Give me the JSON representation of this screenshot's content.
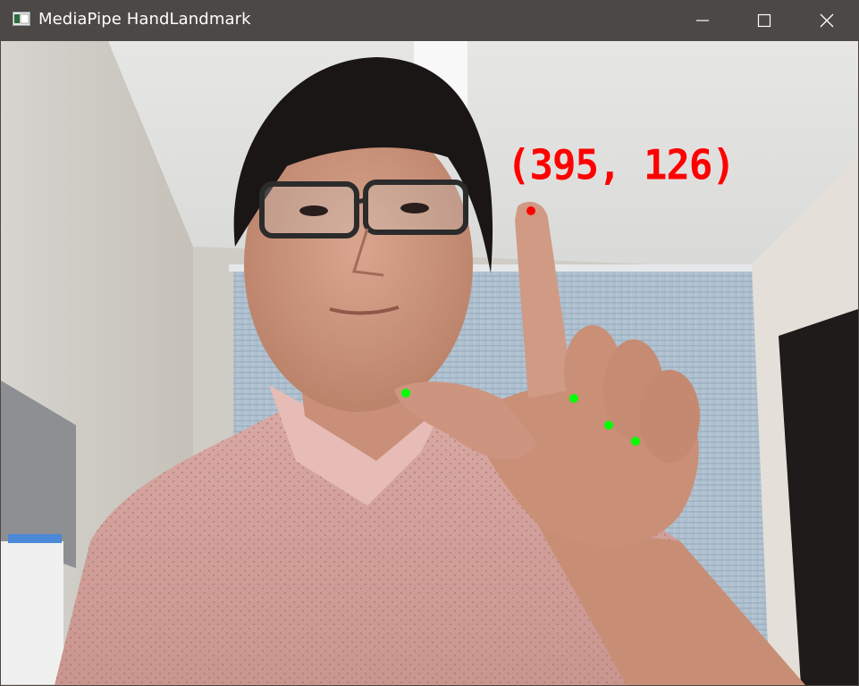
{
  "window": {
    "title": "MediaPipe HandLandmark",
    "app_icon": "opencv-window-icon",
    "controls": [
      "minimize-icon",
      "maximize-icon",
      "close-icon"
    ]
  },
  "camera_frame": {
    "description_free": true,
    "coordinate_label": "(395, 126)",
    "index_fingertip_color": "#ff0000",
    "landmark_color": "#00ff00"
  },
  "colors": {
    "titlebar": "#4b4845",
    "title_text": "#ffffff",
    "label": "#ff0000",
    "landmark": "#00ff00"
  }
}
